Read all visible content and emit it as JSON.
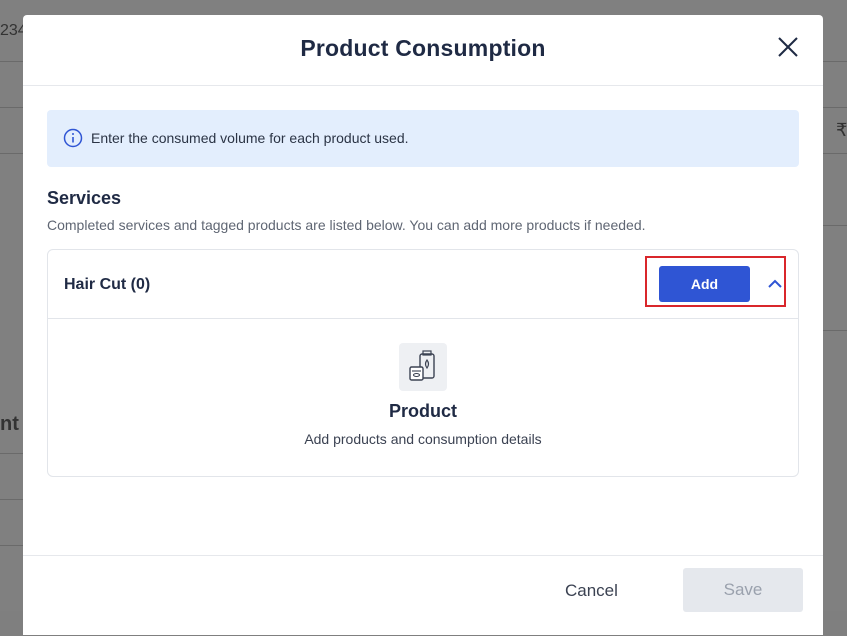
{
  "background": {
    "fragment_top": "234",
    "fragment_left": "nt",
    "fragment_right": "₹"
  },
  "modal": {
    "title": "Product Consumption",
    "info_text": "Enter the consumed volume for each product used.",
    "section_title": "Services",
    "section_subtitle": "Completed services and tagged products are listed below. You can add more products if needed.",
    "service": {
      "name": "Hair Cut (0)",
      "add_label": "Add",
      "empty_title": "Product",
      "empty_subtitle": "Add products and consumption details"
    },
    "footer": {
      "cancel_label": "Cancel",
      "save_label": "Save"
    }
  },
  "icons": [
    "close-icon",
    "info-icon",
    "chevron-up-icon",
    "product-icon"
  ],
  "colors": {
    "primary": "#2f55d4",
    "highlight": "#d9262b",
    "info_bg": "#e3eefd"
  }
}
